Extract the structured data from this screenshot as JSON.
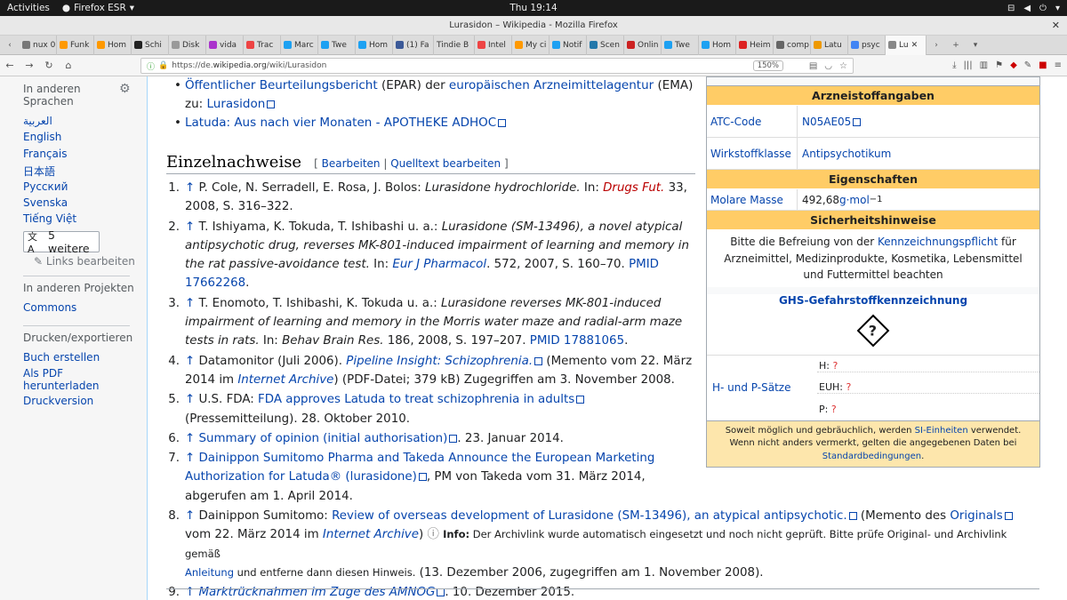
{
  "system": {
    "activities": "Activities",
    "browser": "Firefox ESR",
    "clock": "Thu 19:14"
  },
  "window": {
    "title": "Lurasidon – Wikipedia - Mozilla Firefox"
  },
  "tabs": [
    "nux 0.",
    "Funk",
    "Hom",
    "Schi",
    "Disk",
    "vida",
    "Trac",
    "Marc",
    "Twe",
    "Hom",
    "(1) Fa",
    "Tindie B",
    "Intel",
    "My ci",
    "Notif",
    "Scen",
    "Onlin",
    "Twe",
    "Hom",
    "Heim",
    "comp",
    "Latu",
    "psyc",
    "Lu"
  ],
  "url": {
    "prefix": "https://de.",
    "host": "wikipedia.org",
    "path": "/wiki/Lurasidon",
    "zoom": "150%"
  },
  "sidebar": {
    "other_langs": "In anderen Sprachen",
    "langs": [
      "العربية",
      "English",
      "Français",
      "日本語",
      "Русский",
      "Svenska",
      "Tiếng Việt"
    ],
    "more": "5 weitere",
    "edit_links": "Links bearbeiten",
    "projects": "In anderen Projekten",
    "commons": "Commons",
    "print": "Drucken/exportieren",
    "book": "Buch erstellen",
    "pdf": "Als PDF herunterladen",
    "printver": "Druckversion"
  },
  "prelist": {
    "item1a": "Öffentlicher Beurteilungsbericht",
    "item1b": " (EPAR) der ",
    "item1c": "europäischen Arzneimittelagentur",
    "item1d": " (EMA)",
    "item1e": "zu: ",
    "item1f": "Lurasidon",
    "item2": "Latuda: Aus nach vier Monaten - APOTHEKE ADHOC"
  },
  "heading": {
    "title": "Einzelnachweise",
    "edit": "Bearbeiten",
    "source": "Quelltext bearbeiten"
  },
  "refs": {
    "r1": {
      "a": "P. Cole, N. Serradell, E. Rosa, J. Bolos: ",
      "i": "Lurasidone hydrochloride.",
      "b": " In: ",
      "red": "Drugs Fut.",
      "c": " 33, 2008, S. 316–322."
    },
    "r2": {
      "a": "T. Ishiyama, K. Tokuda, T. Ishibashi u. a.: ",
      "i": "Lurasidone (SM-13496), a novel atypical antipsychotic drug, reverses MK-801-induced impairment of learning and memory in the rat passive-avoidance test.",
      "b": " In: ",
      "l": "Eur J Pharmacol",
      "c": ". 572, 2007, S. 160–70. ",
      "pm": "PMID 17662268",
      "d": "."
    },
    "r3": {
      "a": "T. Enomoto, T. Ishibashi, K. Tokuda u. a.: ",
      "i": "Lurasidone reverses MK-801-induced impairment of learning and memory in the Morris water maze and radial-arm maze tests in rats.",
      "b": " In: ",
      "j": "Behav Brain Res.",
      "c": " 186, 2008, S. 197–207. ",
      "pm": "PMID 17881065",
      "d": "."
    },
    "r4": {
      "a": "Datamonitor (Juli 2006). ",
      "l": "Pipeline Insight: Schizophrenia.",
      "b": " (Memento vom 22. März 2014 im ",
      "ia": "Internet Archive",
      "c": ") (PDF-Datei; 379 kB) Zugegriffen am 3. November 2008."
    },
    "r5": {
      "a": "U.S. FDA: ",
      "l": "FDA approves Latuda to treat schizophrenia in adults",
      "b": " (Pressemitteilung). 28. Oktober 2010."
    },
    "r6": {
      "l": "Summary of opinion (initial authorisation)",
      "b": ". 23. Januar 2014."
    },
    "r7": {
      "l": "Dainippon Sumitomo Pharma and Takeda Announce the European Marketing Authorization for Latuda® (lurasidone)",
      "b": ", PM von Takeda vom 31. März 2014, abgerufen am 1. April 2014."
    },
    "r8": {
      "a": "Dainippon Sumitomo: ",
      "l": "Review of overseas development of Lurasidone (SM-13496), an atypical antipsychotic.",
      "b": " (Memento des ",
      "o": "Originals",
      "c": " vom 22. März 2014 im ",
      "ia": "Internet Archive",
      "d": ") ",
      "info": "Info:",
      "note": " Der Archivlink wurde automatisch eingesetzt und noch nicht geprüft. Bitte prüfe Original- und Archivlink gemäß ",
      "an": "Anleitung",
      "note2": " und entferne dann diesen Hinweis.",
      "e": " (13. Dezember 2006, zugegriffen am 1. November 2008)."
    },
    "r9": {
      "l": "Marktrücknahmen im Zuge des AMNOG",
      "b": ". 10. Dezember 2015."
    }
  },
  "infobox": {
    "h1": "Arzneistoffangaben",
    "atc_k": "ATC-Code",
    "atc_v": "N05AE05",
    "class_k": "Wirkstoffklasse",
    "class_v": "Antipsychotikum",
    "h2": "Eigenschaften",
    "mass_k": "Molare Masse",
    "mass_v": "492,68 ",
    "mass_u": "g·mol",
    "mass_exp": "−1",
    "h3": "Sicherheitshinweise",
    "safety_a": "Bitte die Befreiung von der ",
    "safety_l": "Kennzeichnungspflicht",
    "safety_b": " für Arzneimittel, Medizinprodukte, Kosmetika, Lebensmittel und Futtermittel beachten",
    "ghs": "GHS-Gefahrstoffkennzeichnung",
    "ghs_symbol": "?",
    "hp_k": "H- und P-Sätze",
    "h_label": "H: ",
    "euh_label": "EUH: ",
    "p_label": "P: ",
    "q": "?",
    "foot_a": "Soweit möglich und gebräuchlich, werden ",
    "foot_l": "SI-Einheiten",
    "foot_b": " verwendet. Wenn nicht anders vermerkt, gelten die angegebenen Daten bei ",
    "foot_l2": "Standardbedingungen",
    "foot_c": "."
  }
}
